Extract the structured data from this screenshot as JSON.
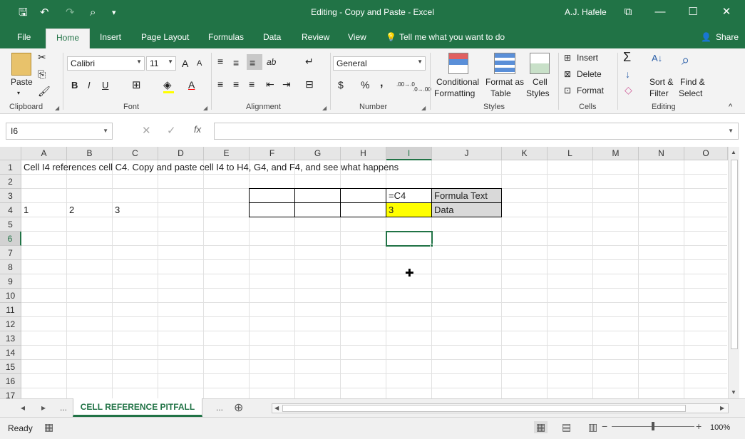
{
  "window": {
    "title": "Editing - Copy and Paste  -  Excel",
    "user": "A.J. Hafele",
    "minimize_icon": "—",
    "restore_icon": "☐",
    "close_icon": "✕",
    "ribbon_display_icon": "⧉"
  },
  "quick_access": {
    "save_icon": "🖫",
    "undo_icon": "↶",
    "redo_icon": "↷",
    "print_preview_icon": "⌕",
    "customize_icon": "▾"
  },
  "tabs": {
    "file": "File",
    "home": "Home",
    "insert": "Insert",
    "page_layout": "Page Layout",
    "formulas": "Formulas",
    "data": "Data",
    "review": "Review",
    "view": "View",
    "tell_me": "Tell me what you want to do",
    "share": "Share",
    "lightbulb_icon": "💡",
    "user_icon": "👤"
  },
  "ribbon": {
    "clipboard": {
      "label": "Clipboard",
      "paste": "Paste",
      "cut_icon": "✂",
      "copy_icon": "⎘",
      "format_painter_icon": "🖌"
    },
    "font": {
      "label": "Font",
      "font_name": "Calibri",
      "font_size": "11",
      "grow": "A",
      "shrink": "A",
      "bold": "B",
      "italic": "I",
      "underline": "U",
      "border_icon": "⊞",
      "fill_icon": "◈",
      "font_color": "A"
    },
    "alignment": {
      "label": "Alignment",
      "top_align": "≡",
      "middle_align": "≡",
      "bottom_align": "≡",
      "orientation": "ab",
      "wrap_icon": "↵",
      "align_left": "≡",
      "center": "≡",
      "align_right": "≡",
      "decrease_indent": "⇤",
      "increase_indent": "⇥",
      "merge_icon": "⊟"
    },
    "number": {
      "label": "Number",
      "format": "General",
      "currency": "$",
      "percent": "%",
      "comma": ",",
      "inc_decimal": ".00→.0",
      "dec_decimal": ".0→.00"
    },
    "styles": {
      "label": "Styles",
      "conditional_formatting_1": "Conditional",
      "conditional_formatting_2": "Formatting",
      "format_as_table_1": "Format as",
      "format_as_table_2": "Table",
      "cell_styles_1": "Cell",
      "cell_styles_2": "Styles"
    },
    "cells": {
      "label": "Cells",
      "insert": "Insert",
      "delete": "Delete",
      "format": "Format"
    },
    "editing": {
      "label": "Editing",
      "autosum": "Σ",
      "fill": "↓",
      "clear": "◇",
      "sort_1": "Sort &",
      "sort_2": "Filter",
      "find_1": "Find &",
      "find_2": "Select",
      "collapse_icon": "^"
    }
  },
  "formula_bar": {
    "name_box": "I6",
    "cancel_icon": "✕",
    "enter_icon": "✓",
    "fx": "fx",
    "formula": ""
  },
  "grid": {
    "columns": [
      "A",
      "B",
      "C",
      "D",
      "E",
      "F",
      "G",
      "H",
      "I",
      "J",
      "K",
      "L",
      "M",
      "N",
      "O"
    ],
    "rows": [
      "1",
      "2",
      "3",
      "4",
      "5",
      "6",
      "7",
      "8",
      "9",
      "10",
      "11",
      "12",
      "13",
      "14",
      "15",
      "16",
      "17"
    ],
    "cells": {
      "A1": "Cell I4 references cell C4.  Copy and paste cell I4 to H4, G4, and F4, and see what happens",
      "I3": "=C4",
      "J3": "Formula Text",
      "A4": "1",
      "B4": "2",
      "C4": "3",
      "I4": "3",
      "J4": "Data"
    },
    "highlight_color": "#ffff00",
    "label_fill_color": "#d9d9d9",
    "accent": "#217346"
  },
  "sheet_tabs": {
    "prev": "◂",
    "next": "▸",
    "more_left": "...",
    "active": "CELL REFERENCE PITFALL",
    "more_right": "...",
    "add_icon": "⊕"
  },
  "status": {
    "ready": "Ready",
    "macro_icon": "▦",
    "normal_view_icon": "▦",
    "page_layout_icon": "▤",
    "page_break_icon": "▥",
    "zoom_out": "−",
    "zoom_in": "+",
    "zoom": "100%",
    "zoom_level": 0.5
  }
}
